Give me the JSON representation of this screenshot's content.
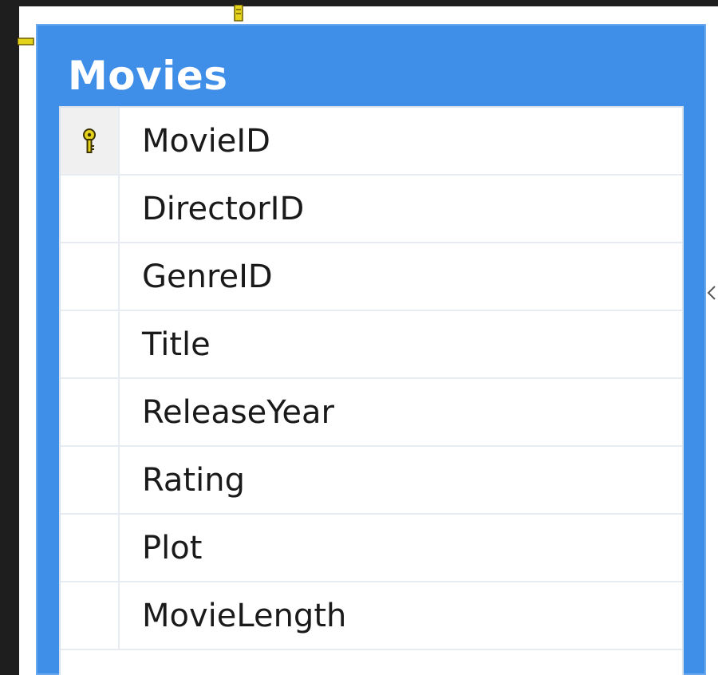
{
  "table": {
    "title": "Movies",
    "columns": [
      {
        "name": "MovieID",
        "primary_key": true
      },
      {
        "name": "DirectorID",
        "primary_key": false
      },
      {
        "name": "GenreID",
        "primary_key": false
      },
      {
        "name": "Title",
        "primary_key": false
      },
      {
        "name": "ReleaseYear",
        "primary_key": false
      },
      {
        "name": "Rating",
        "primary_key": false
      },
      {
        "name": "Plot",
        "primary_key": false
      },
      {
        "name": "MovieLength",
        "primary_key": false
      }
    ]
  },
  "icons": {
    "primary_key": "key-icon",
    "relationship": "relationship-connector-icon"
  },
  "colors": {
    "title_bar": "#3f8fe8",
    "key": "#e5d21a",
    "background": "#1e1e1e"
  }
}
